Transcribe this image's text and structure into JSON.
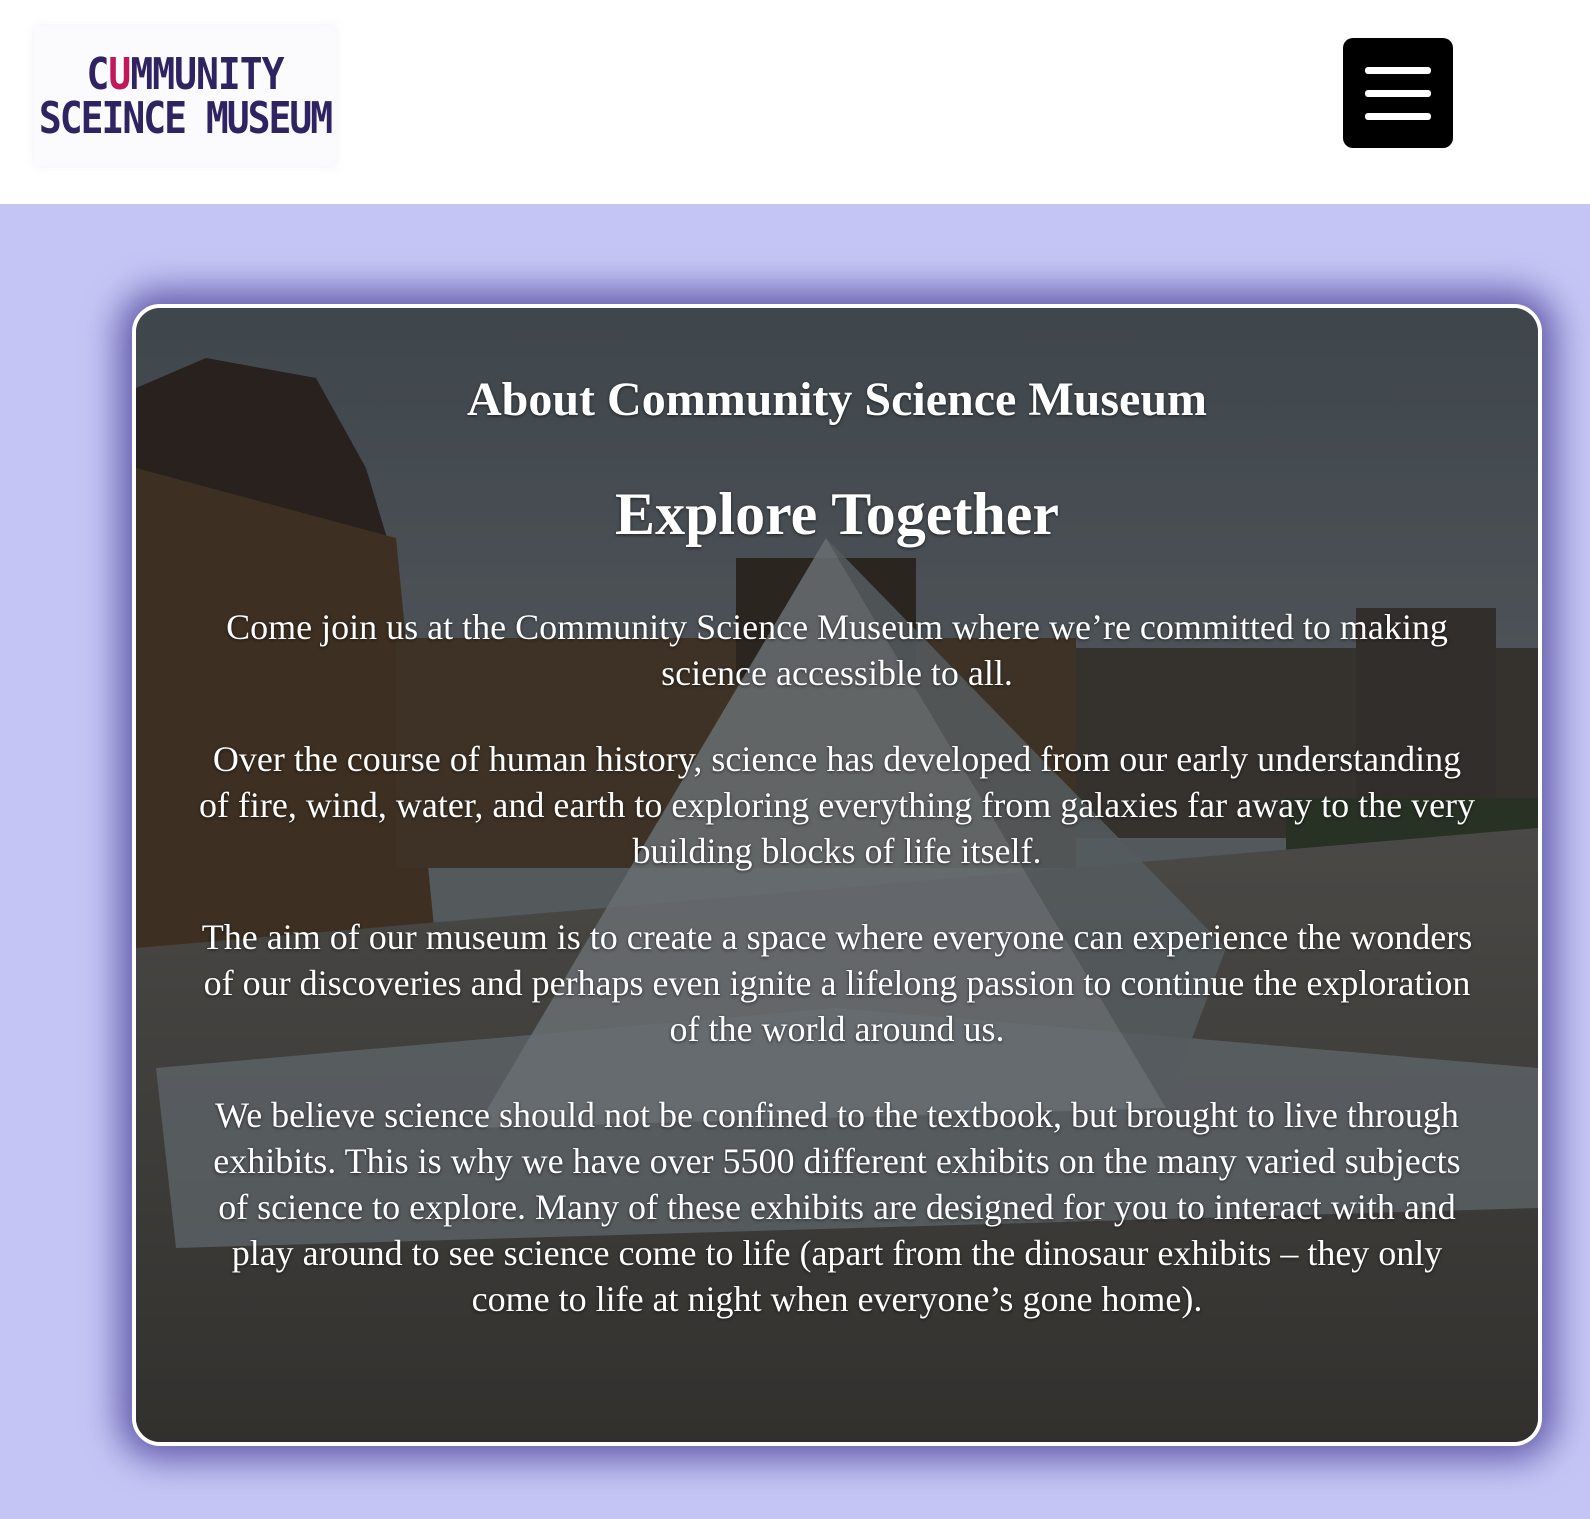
{
  "header": {
    "logo": {
      "line1_prefix": "C",
      "line1_mark": "U",
      "line1_suffix": "MMUNITY",
      "line2": "SCEINCE MUSEUM"
    },
    "menu_icon": "hamburger-menu-icon"
  },
  "about": {
    "heading": "About Community Science Museum",
    "subheading": "Explore Together",
    "paragraphs": [
      "Come join us at the Community Science Museum where we’re committed to making science accessible to all.",
      "Over the course of human history, science has developed from our early understanding of fire, wind, water, and earth to exploring everything from galaxies far away to the very building blocks of life itself.",
      "The aim of our museum is to create a space where everyone can experience the wonders of our discoveries and perhaps even ignite a lifelong passion to continue the exploration of the world around us.",
      "We believe science should not be confined to the textbook, but brought to live through exhibits. This is why we have over 5500 different exhibits on the many varied subjects of science to explore. Many of these exhibits are designed for you to interact with and play around to see science come to life (apart from the dinosaur exhibits – they only come to life at night when everyone’s gone home)."
    ]
  },
  "colors": {
    "page_background": "#c5c5f5",
    "logo_text": "#2f2461",
    "logo_accent": "#c2185b",
    "menu_button": "#000000",
    "card_border": "#ffffff"
  }
}
